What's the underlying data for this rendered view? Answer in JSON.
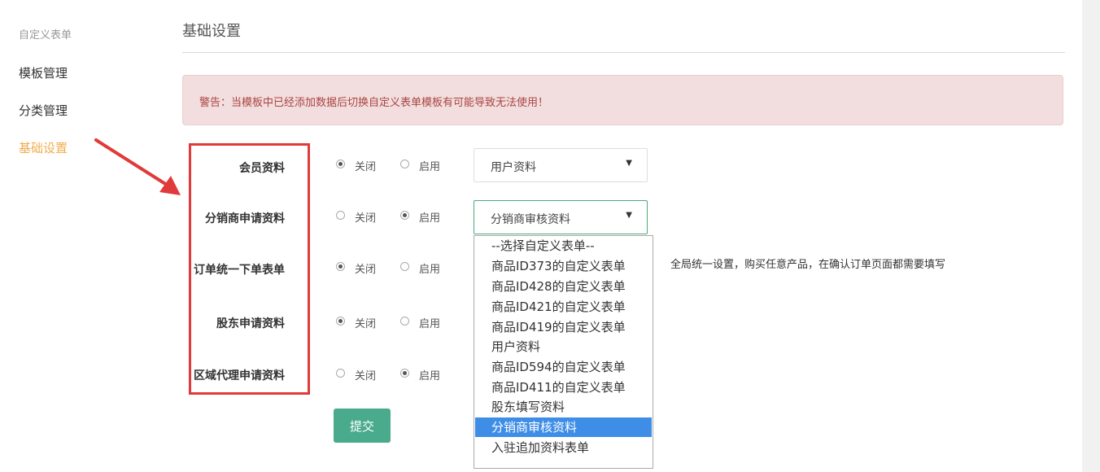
{
  "sidebar": {
    "header": "自定义表单",
    "items": [
      {
        "label": "模板管理",
        "active": false
      },
      {
        "label": "分类管理",
        "active": false
      },
      {
        "label": "基础设置",
        "active": true
      }
    ]
  },
  "main": {
    "title": "基础设置",
    "alert": "警告：当模板中已经添加数据后切换自定义表单模板有可能导致无法使用！",
    "radio_off_label": "关闭",
    "radio_on_label": "启用",
    "rows": [
      {
        "label": "会员资料",
        "state": "关闭",
        "select_value": "用户资料"
      },
      {
        "label": "分销商申请资料",
        "state": "启用",
        "select_value": "分销商审核资料"
      },
      {
        "label": "订单统一下单表单",
        "state": "关闭"
      },
      {
        "label": "股东申请资料",
        "state": "关闭"
      },
      {
        "label": "区域代理申请资料",
        "state": "启用"
      }
    ],
    "help_text": "全局统一设置，购买任意产品，在确认订单页面都需要填写",
    "submit_label": "提交"
  },
  "dropdown": {
    "options": [
      "--选择自定义表单--",
      "商品ID373的自定义表单",
      "商品ID428的自定义表单",
      "商品ID421的自定义表单",
      "商品ID419的自定义表单",
      "用户资料",
      "商品ID594的自定义表单",
      "商品ID411的自定义表单",
      "股东填写资料",
      "分销商审核资料",
      "入驻追加资料表单"
    ],
    "selected": "分销商审核资料"
  },
  "colors": {
    "accent": "#f0ad4e",
    "alert_bg": "#f2dede",
    "alert_text": "#a94442",
    "highlight": "#e03a3a",
    "submit": "#49ab8b",
    "option_selected": "#3e8de6"
  },
  "icons": {
    "caret": "caret-down-icon",
    "arrow": "annotation-arrow-icon"
  }
}
